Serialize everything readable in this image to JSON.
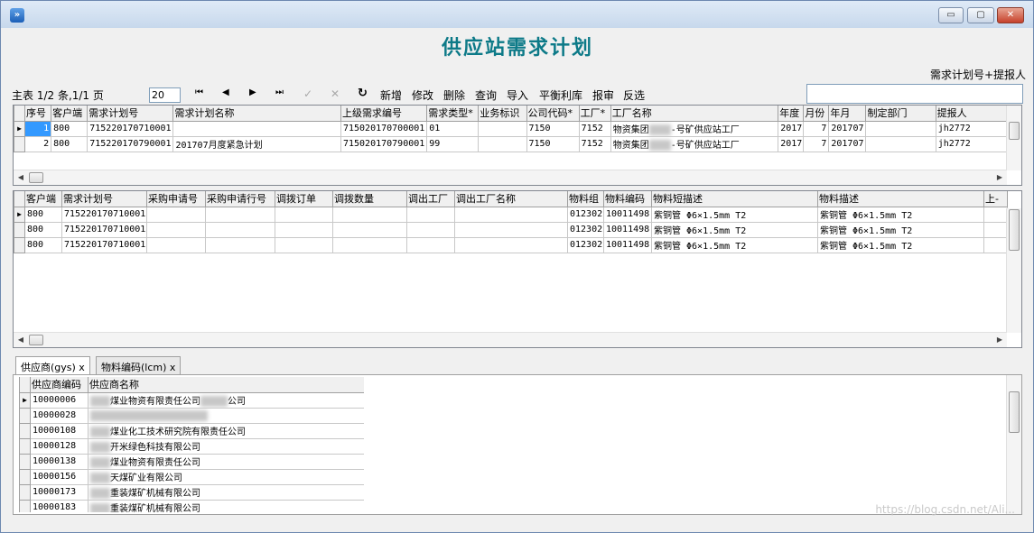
{
  "window": {
    "min": "▭",
    "max": "▢",
    "close": "✕",
    "app_icon": "»"
  },
  "app_title": "供应站需求计划",
  "search": {
    "label": "需求计划号+提报人",
    "value": ""
  },
  "pager": {
    "text": "主表 1/2 条,1/1 页",
    "page_size": "20"
  },
  "toolbar": {
    "first": "⏮",
    "prev": "◀",
    "next": "▶",
    "last": "⏭",
    "confirm": "✓",
    "cancel": "✕",
    "refresh": "↻",
    "add": "新增",
    "edit": "修改",
    "delete": "删除",
    "query": "查询",
    "import": "导入",
    "balance": "平衡利库",
    "report": "报审",
    "invert": "反选"
  },
  "master": {
    "columns": [
      "序号",
      "客户端",
      "需求计划号",
      "需求计划名称",
      "上级需求编号",
      "需求类型*",
      "业务标识",
      "公司代码*",
      "工厂*",
      "工厂名称",
      "年度",
      "月份",
      "年月",
      "制定部门",
      "提报人"
    ],
    "rows": [
      [
        "1",
        "800",
        "715220170710001",
        "",
        "715020170700001",
        "01",
        "",
        "7150",
        "7152",
        "物资集团",
        "-号矿供应站工厂",
        "2017",
        "7",
        "201707",
        "",
        "jh2772"
      ],
      [
        "2",
        "800",
        "715220170790001",
        "201707月度紧急计划",
        "715020170790001",
        "99",
        "",
        "7150",
        "7152",
        "物资集团",
        "-号矿供应站工厂",
        "2017",
        "7",
        "201707",
        "",
        "jh2772"
      ]
    ]
  },
  "detail": {
    "columns": [
      "客户端",
      "需求计划号",
      "采购申请号",
      "采购申请行号",
      "调拨订单",
      "调拨数量",
      "调出工厂",
      "调出工厂名称",
      "物料组",
      "物料编码",
      "物料短描述",
      "物料描述",
      "上-"
    ],
    "rows": [
      [
        "800",
        "715220170710001",
        "",
        "",
        "",
        "",
        "",
        "",
        "012302",
        "10011498",
        "紫铜管 Φ6×1.5mm T2",
        "紫铜管 Φ6×1.5mm T2",
        ""
      ],
      [
        "800",
        "715220170710001",
        "",
        "",
        "",
        "",
        "",
        "",
        "012302",
        "10011498",
        "紫铜管 Φ6×1.5mm T2",
        "紫铜管 Φ6×1.5mm T2",
        ""
      ],
      [
        "800",
        "715220170710001",
        "",
        "",
        "",
        "",
        "",
        "",
        "012302",
        "10011498",
        "紫铜管 Φ6×1.5mm T2",
        "紫铜管 Φ6×1.5mm T2",
        ""
      ]
    ]
  },
  "tabs": [
    {
      "label": "供应商(gys) x"
    },
    {
      "label": "物料编码(lcm) x"
    }
  ],
  "supplier": {
    "columns": [
      "供应商编码",
      "供应商名称"
    ],
    "rows": [
      [
        "10000006",
        "煤业物资有限责任公司",
        "公司"
      ],
      [
        "10000028",
        "",
        ""
      ],
      [
        "10000108",
        "煤业化工技术研究院有限责任公司",
        ""
      ],
      [
        "10000128",
        "开米绿色科技有限公司",
        ""
      ],
      [
        "10000138",
        "煤业物资有限责任公司",
        ""
      ],
      [
        "10000156",
        "天煤矿业有限公司",
        ""
      ],
      [
        "10000173",
        "重装煤矿机械有限公司",
        ""
      ],
      [
        "10000183",
        "重装煤矿机械有限公司",
        ""
      ]
    ]
  },
  "watermark": "https://blog.csdn.net/Ali..."
}
